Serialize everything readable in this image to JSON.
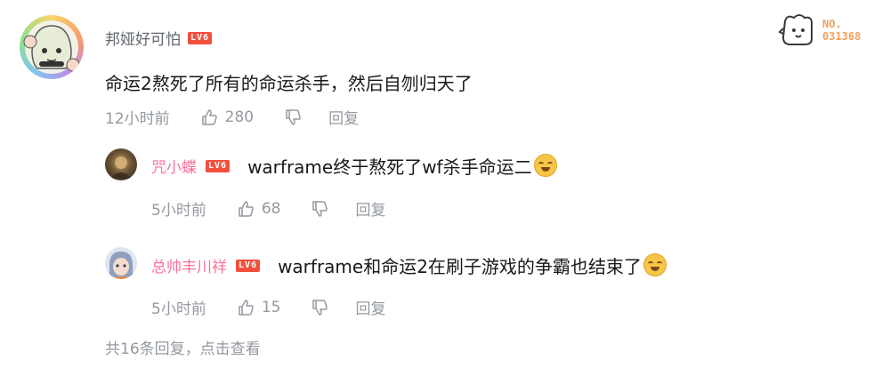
{
  "comment": {
    "username": "邦娅好可怕",
    "level": "LV6",
    "text": "命运2熬死了所有的命运杀手，然后自刎归天了",
    "time": "12小时前",
    "likes": "280",
    "reply_label": "回复"
  },
  "fan_badge": {
    "label": "NO.",
    "number": "031368"
  },
  "replies": [
    {
      "username": "咒小蝶",
      "level": "LV6",
      "text": "warframe终于熬死了wf杀手命运二",
      "emoji": "laugh-cry-emoji",
      "time": "5小时前",
      "likes": "68",
      "reply_label": "回复"
    },
    {
      "username": "总帅丰川祥",
      "level": "LV6",
      "text": "warframe和命运2在刷子游戏的争霸也结束了",
      "emoji": "laugh-cry-emoji",
      "time": "5小时前",
      "likes": "15",
      "reply_label": "回复"
    }
  ],
  "footer": {
    "summary": "共16条回复，点击查看"
  },
  "colors": {
    "username_main": "#61666d",
    "username_reply": "#fb7299",
    "meta_gray": "#9499a0",
    "level_badge": "#f24f3e"
  }
}
